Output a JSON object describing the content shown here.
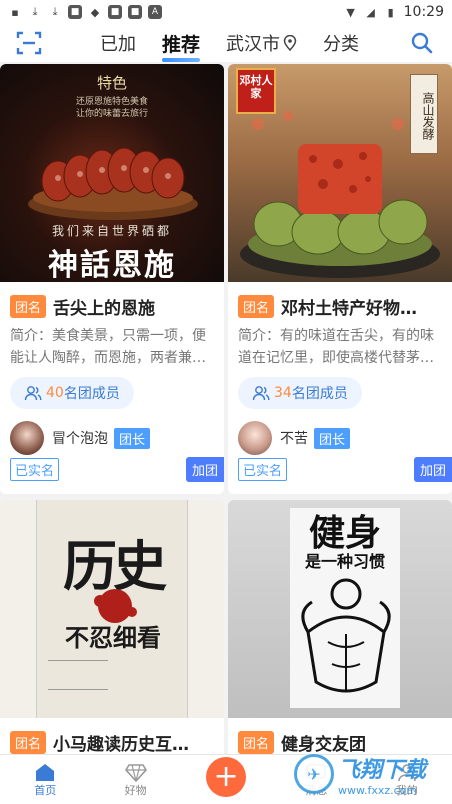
{
  "status_bar": {
    "time": "10:29"
  },
  "header": {
    "tabs": [
      "已加",
      "推荐",
      "武汉市",
      "分类"
    ],
    "active_tab": "推荐"
  },
  "cards": [
    {
      "tag": "团名",
      "name": "舌尖上的恩施",
      "desc": "简介：美食美景，只需一项，便能让人陶醉，而恩施，两者兼…",
      "members_count": "40",
      "members_label": "名团成员",
      "owner": "冒个泡泡",
      "owner_role": "团长",
      "verified": "已实名",
      "join": "加团",
      "cover_text": {
        "badge": "特色",
        "line1": "还原恩施特色美食",
        "line2": "让你的味蕾去旅行",
        "tagline": "我们来自世界硒都",
        "title": "神話恩施"
      }
    },
    {
      "tag": "团名",
      "name": "邓村土特产好物…",
      "desc": "简介：有的味道在舌尖，有的味道在记忆里，即使高楼代替茅…",
      "members_count": "34",
      "members_label": "名团成员",
      "owner": "不苦",
      "owner_role": "团长",
      "verified": "已实名",
      "join": "加团",
      "cover_text": {
        "brand": "邓村人家",
        "side": "高山发酵"
      }
    },
    {
      "tag": "团名",
      "name": "小马趣读历史互…",
      "cover_text": {
        "big1": "历史",
        "big2": "不忍细看"
      }
    },
    {
      "tag": "团名",
      "name": "健身交友团",
      "cover_text": {
        "big1": "健身",
        "big2": "是一种习惯"
      }
    }
  ],
  "tabbar": {
    "items": [
      "首页",
      "好物",
      "",
      "消息",
      "我的"
    ]
  },
  "watermark": {
    "big": "飞翔下载",
    "small": "www.fxxz.com"
  },
  "colors": {
    "accent": "#3a7bd5",
    "orange": "#ff8a3d",
    "plus": "#ff6a3d"
  }
}
